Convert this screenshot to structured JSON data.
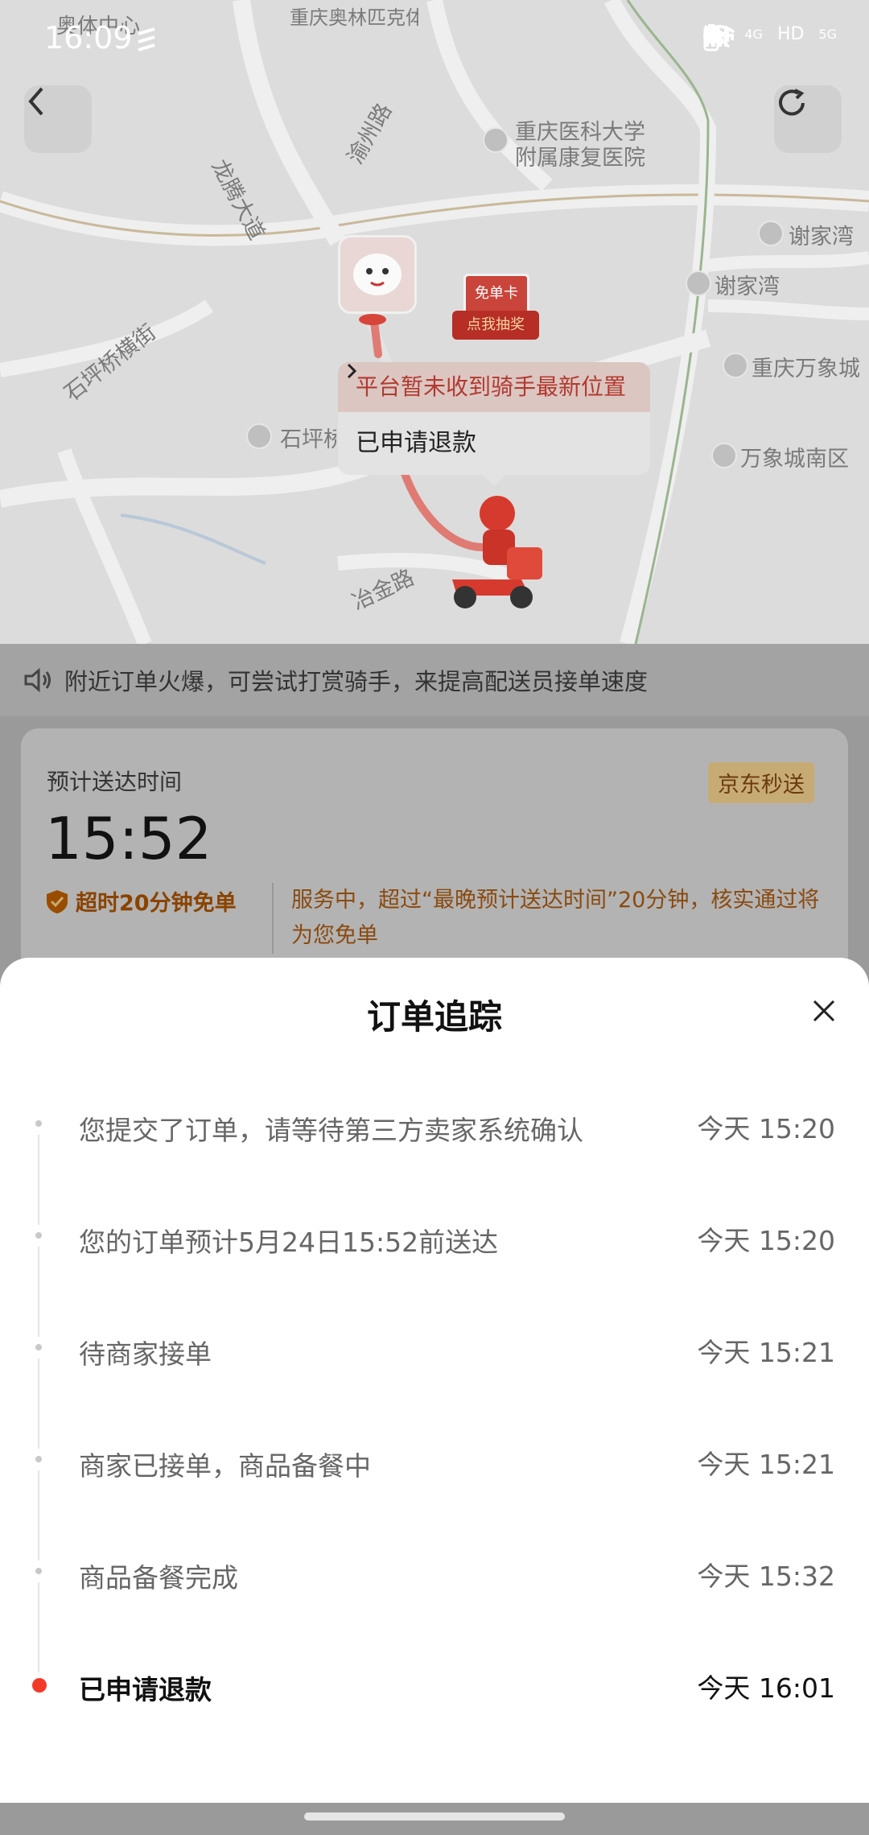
{
  "status_bar": {
    "time": "16:09",
    "network_labels": [
      "HD",
      "4G",
      "HD",
      "5G"
    ]
  },
  "map": {
    "labels": [
      "奥体中心",
      "重庆奥林匹克体育中心",
      "重庆医科大学",
      "附属康复医院",
      "谢家湾",
      "谢家湾",
      "重庆万象城",
      "万象城南区",
      "石坪桥横街",
      "石坪桥",
      "冶金路",
      "龙腾大道",
      "渝州路"
    ],
    "popup": {
      "message": "平台暂未收到骑手最新位置",
      "refund_link": "已申请退款"
    },
    "coupon": {
      "title": "免单卡",
      "action": "点我抽奖"
    }
  },
  "notice": {
    "text": "附近订单火爆，可尝试打赏骑手，来提高配送员接单速度"
  },
  "eta": {
    "label": "预计送达时间",
    "time": "15:52",
    "badge": "京东秒送",
    "guarantee": "超时20分钟免单",
    "guarantee_desc": "服务中，超过“最晚预计送达时间”20分钟，核实通过将为您免单"
  },
  "sheet": {
    "title": "订单追踪",
    "events": [
      {
        "text": "您提交了订单，请等待第三方卖家系统确认",
        "time": "今天 15:20"
      },
      {
        "text": "您的订单预计5月24日15:52前送达",
        "time": "今天 15:20"
      },
      {
        "text": "待商家接单",
        "time": "今天 15:21"
      },
      {
        "text": "商家已接单，商品备餐中",
        "time": "今天 15:21"
      },
      {
        "text": "商品备餐完成",
        "time": "今天 15:32"
      },
      {
        "text": "已申请退款",
        "time": "今天 16:01"
      }
    ]
  },
  "colors": {
    "accent_red": "#f23a2a",
    "guarantee_orange": "#8a4300",
    "badge_bg": "#c7ab74"
  },
  "icons": [
    "back-arrow-icon",
    "refresh-icon",
    "speaker-icon",
    "shield-icon",
    "close-icon",
    "chevron-right-icon"
  ]
}
